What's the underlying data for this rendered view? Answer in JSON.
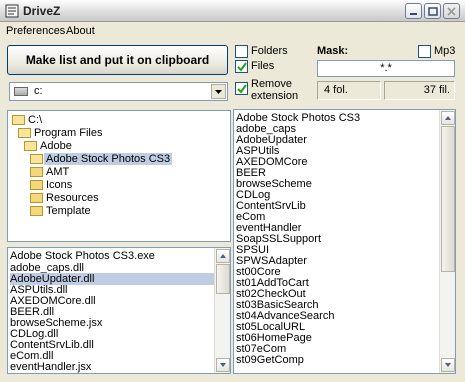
{
  "window": {
    "title": "DriveZ"
  },
  "menu": {
    "items": [
      {
        "label": "Preferences"
      },
      {
        "label": "About"
      }
    ]
  },
  "actions": {
    "make_list_label": "Make list and put it on clipboard"
  },
  "options": {
    "folders_label": "Folders",
    "folders_checked": false,
    "files_label": "Files",
    "files_checked": true,
    "remove_ext_label_1": "Remove",
    "remove_ext_label_2": "extension",
    "remove_ext_checked": true,
    "mp3_label": "Mp3",
    "mp3_checked": false
  },
  "mask": {
    "label": "Mask:",
    "value": "*.*"
  },
  "drive": {
    "value": "c:"
  },
  "status": {
    "folders": "4 fol.",
    "files": "37 fil."
  },
  "tree": {
    "items": [
      "C:\\",
      "Program Files",
      "Adobe",
      "Adobe Stock Photos CS3",
      "AMT",
      "Icons",
      "Resources",
      "Template"
    ]
  },
  "file_list": {
    "items": [
      "Adobe Stock Photos CS3.exe",
      "adobe_caps.dll",
      "AdobeUpdater.dll",
      "ASPUtils.dll",
      "AXEDOMCore.dll",
      "BEER.dll",
      "browseScheme.jsx",
      "CDLog.dll",
      "ContentSrvLib.dll",
      "eCom.dll",
      "eventHandler.jsx"
    ]
  },
  "result_list": {
    "items": [
      "Adobe Stock Photos CS3",
      "adobe_caps",
      "AdobeUpdater",
      "ASPUtils",
      "AXEDOMCore",
      "BEER",
      "browseScheme",
      "CDLog",
      "ContentSrvLib",
      "eCom",
      "eventHandler",
      "SoapSSLSupport",
      "SPSUI",
      "SPWSAdapter",
      "st00Core",
      "st01AddToCart",
      "st02CheckOut",
      "st03BasicSearch",
      "st04AdvanceSearch",
      "st05LocalURL",
      "st06HomePage",
      "st07eCom",
      "st09GetComp"
    ]
  }
}
